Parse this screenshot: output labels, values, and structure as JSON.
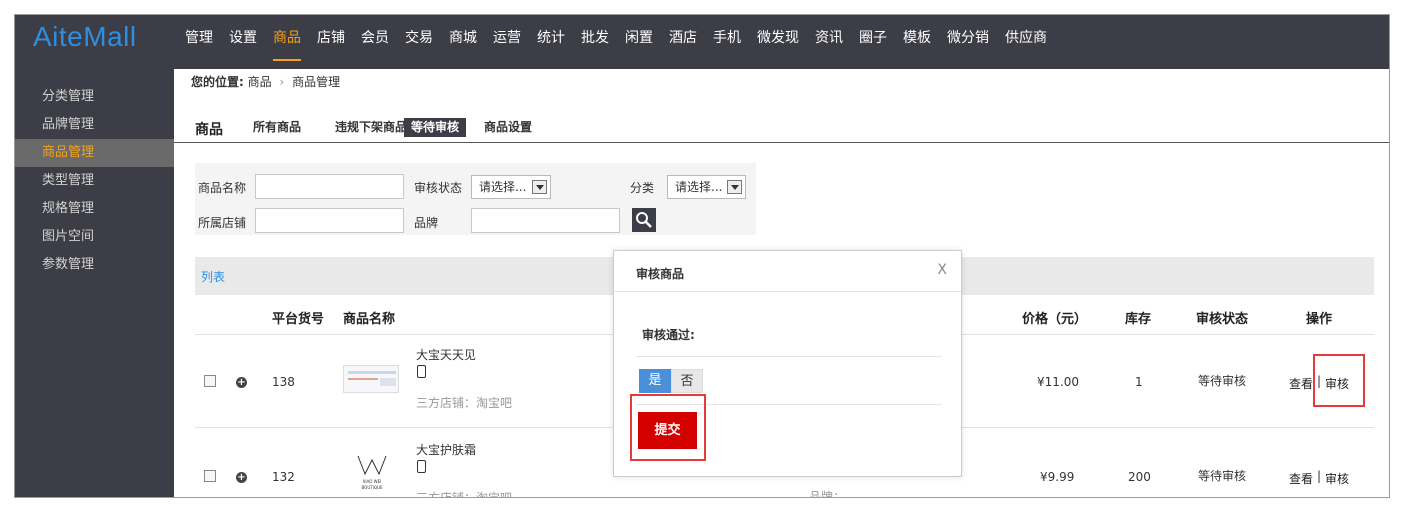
{
  "logo": "AiteMall",
  "nav": [
    "管理",
    "设置",
    "商品",
    "店铺",
    "会员",
    "交易",
    "商城",
    "运营",
    "统计",
    "批发",
    "闲置",
    "酒店",
    "手机",
    "微发现",
    "资讯",
    "圈子",
    "模板",
    "微分销",
    "供应商"
  ],
  "nav_active": "商品",
  "sidebar": [
    "分类管理",
    "品牌管理",
    "商品管理",
    "类型管理",
    "规格管理",
    "图片空间",
    "参数管理"
  ],
  "breadcrumb": {
    "prefix": "您的位置:",
    "level1": "商品",
    "sep": "›",
    "level2": "商品管理"
  },
  "tabs": {
    "title": "商品",
    "items": [
      "所有商品",
      "违规下架商品",
      "等待审核",
      "商品设置"
    ],
    "active": "等待审核"
  },
  "filter": {
    "name_label": "商品名称",
    "status_label": "审核状态",
    "status_value": "请选择...",
    "category_label": "分类",
    "category_value": "请选择...",
    "shop_label": "所属店铺",
    "brand_label": "品牌"
  },
  "list": {
    "title": "列表",
    "headers": {
      "sku": "平台货号",
      "name": "商品名称",
      "price": "价格（元）",
      "stock": "库存",
      "status": "审核状态",
      "ops": "操作"
    },
    "rows": [
      {
        "sku": "138",
        "name": "大宝天天见",
        "shop": "三方店铺：淘宝吧",
        "price": "¥11.00",
        "stock": "1",
        "status": "等待审核",
        "view": "查看",
        "sep": "|",
        "audit": "审核"
      },
      {
        "sku": "132",
        "name": "大宝护肤霜",
        "shop": "三方店铺：淘宝吧",
        "price": "¥9.99",
        "stock": "200",
        "status": "等待审核",
        "view": "查看",
        "sep": "|",
        "audit": "审核",
        "brand_label": "品牌：",
        "logo_line1": "XIAO WEI",
        "logo_line2": "BOUTIQUE"
      }
    ]
  },
  "modal": {
    "title": "审核商品",
    "close": "X",
    "pass_label": "审核通过:",
    "yes": "是",
    "no": "否",
    "submit": "提交"
  },
  "colors": {
    "topbar": "#3c3d46",
    "accent": "#f7a21b",
    "logo": "#2e8fe0",
    "submit": "#d40000",
    "highlight": "#e63b3b"
  }
}
